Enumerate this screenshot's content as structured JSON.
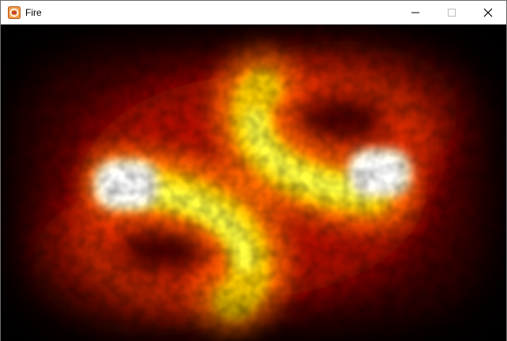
{
  "window": {
    "title": "Fire",
    "icon": "fire-app-icon",
    "controls": {
      "minimize_icon": "minimize-icon",
      "maximize_icon": "maximize-icon",
      "close_icon": "close-icon"
    }
  },
  "scene": {
    "description_colors": {
      "core": "#ffffff",
      "hot": "#ffff00",
      "warm": "#ff7a00",
      "glow": "#c80000",
      "background": "#000000"
    }
  }
}
